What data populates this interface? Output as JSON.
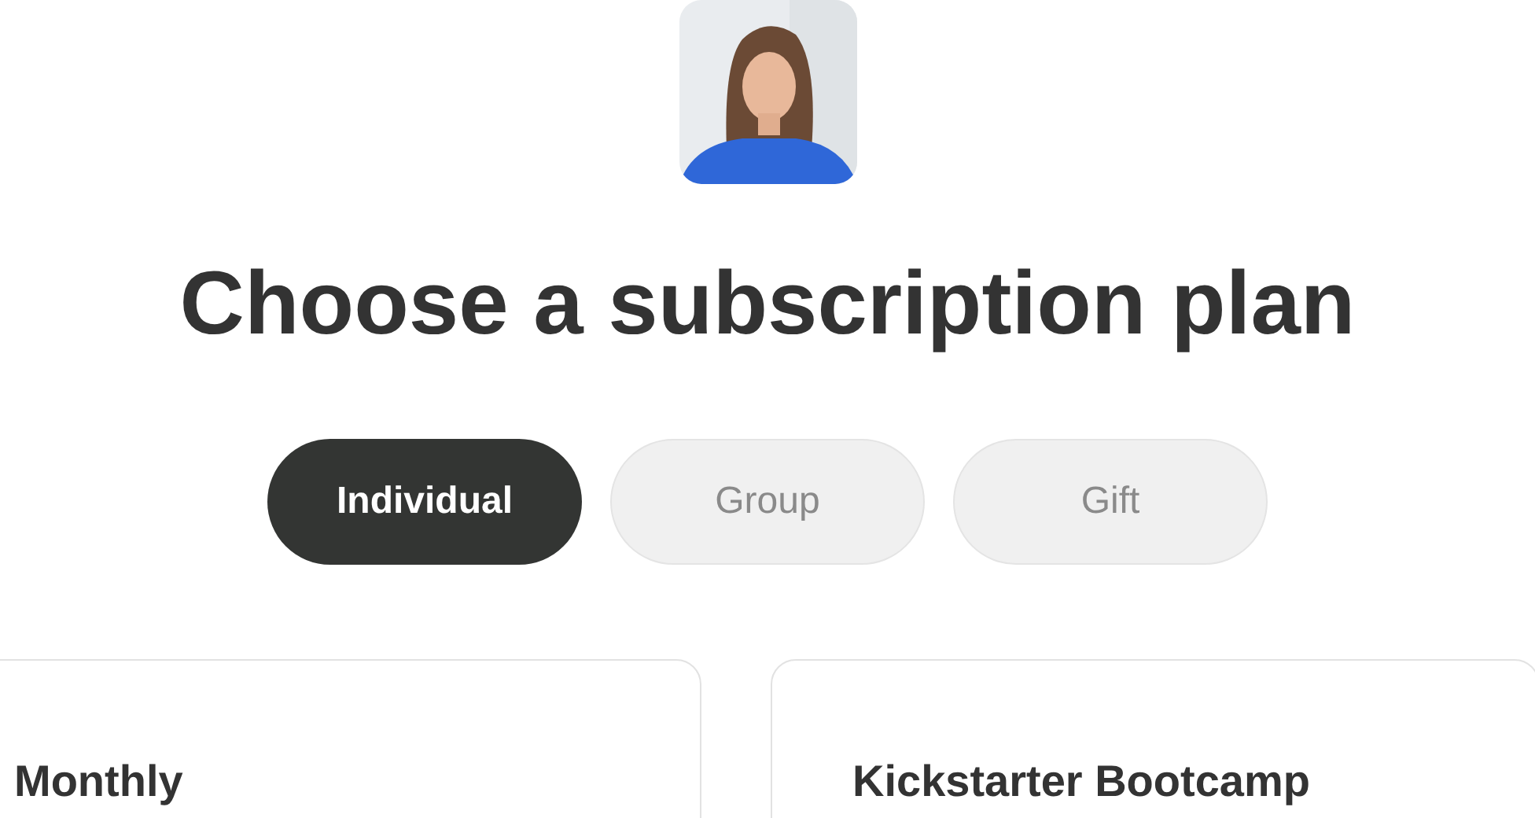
{
  "title": "Choose a subscription plan",
  "tabs": [
    {
      "label": "Individual",
      "selected": true
    },
    {
      "label": "Group",
      "selected": false
    },
    {
      "label": "Gift",
      "selected": false
    }
  ],
  "plans": [
    {
      "name": "Monthly"
    },
    {
      "name": "Kickstarter Bootcamp"
    }
  ]
}
